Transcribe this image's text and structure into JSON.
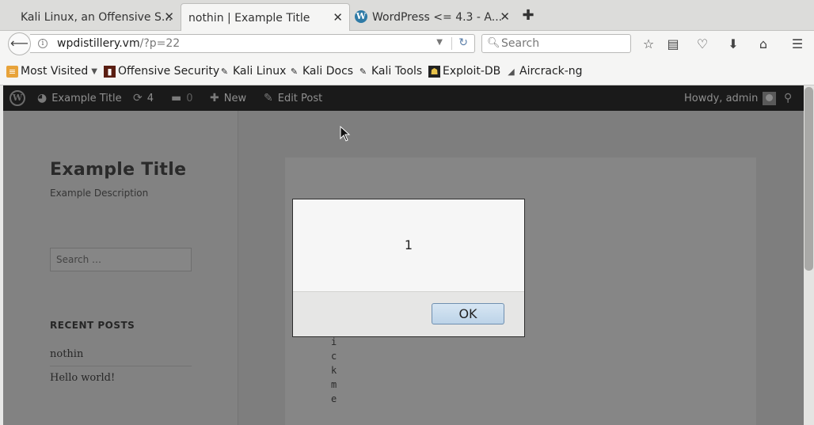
{
  "browser": {
    "tabs": [
      {
        "title": "Kali Linux, an Offensive S...",
        "active": false
      },
      {
        "title": "nothin | Example Title",
        "active": true
      },
      {
        "title": "WordPress <= 4.3 - A...",
        "active": false
      }
    ],
    "url_host": "wpdistillery.vm",
    "url_path": "/?p=22",
    "search_placeholder": "Search",
    "bookmarks": [
      {
        "label": "Most Visited",
        "icon": "most-visited-icon"
      },
      {
        "label": "Offensive Security",
        "icon": "offsec-icon"
      },
      {
        "label": "Kali Linux",
        "icon": "kali-dragon-icon"
      },
      {
        "label": "Kali Docs",
        "icon": "kali-dragon-icon"
      },
      {
        "label": "Kali Tools",
        "icon": "kali-dragon-icon"
      },
      {
        "label": "Exploit-DB",
        "icon": "exploitdb-icon"
      },
      {
        "label": "Aircrack-ng",
        "icon": "aircrack-icon"
      }
    ]
  },
  "wp_admin_bar": {
    "site_name": "Example Title",
    "updates_count": "4",
    "comments_count": "0",
    "new_label": "New",
    "edit_post_label": "Edit Post",
    "howdy": "Howdy, admin"
  },
  "site": {
    "title": "Example Title",
    "description": "Example Description",
    "search_placeholder": "Search …",
    "recent_posts_title": "RECENT POSTS",
    "recent_posts": [
      "nothin",
      "Hello world!"
    ],
    "vertical_text": [
      "i",
      "c",
      "k",
      "m",
      "e"
    ]
  },
  "alert": {
    "message": "1",
    "ok_label": "OK"
  },
  "colors": {
    "admin_bar": "#1a1a1a",
    "dim_overlay": "#7e7e7e",
    "ok_button": "#c9dcee"
  }
}
